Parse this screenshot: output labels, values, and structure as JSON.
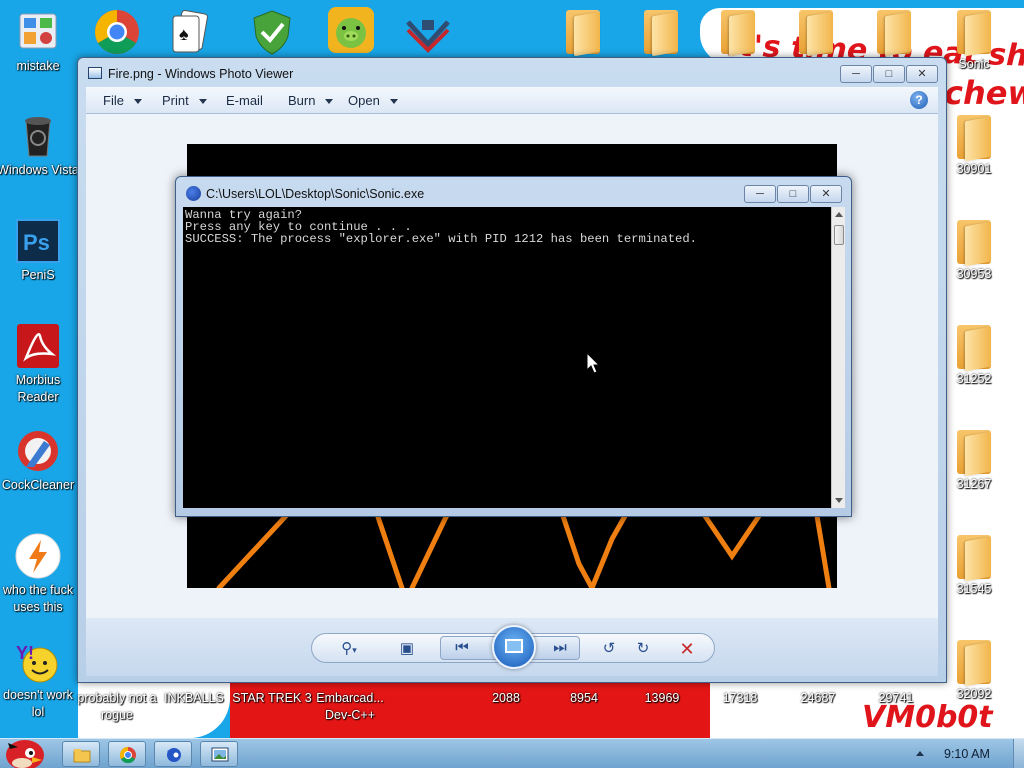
{
  "desktop": {
    "background_text_top": "It's time to eat shit",
    "background_text_chew": "chew",
    "watermark": "VM0b0t",
    "icons_left": [
      {
        "label": "mistake",
        "icon": "control-panel-icon"
      },
      {
        "label": "Windows Vista",
        "icon": "recycle-bin-icon"
      },
      {
        "label": "PeniS",
        "icon": "photoshop-icon"
      },
      {
        "label": "Morbius Reader",
        "icon": "adobe-reader-icon"
      },
      {
        "label": "CockCleaner",
        "icon": "ccleaner-icon"
      },
      {
        "label": "who the fuck uses this",
        "icon": "winamp-icon"
      },
      {
        "label": "doesn't work lol",
        "icon": "yahoo-messenger-icon"
      }
    ],
    "icons_top": [
      {
        "label": "",
        "icon": "chrome-icon"
      },
      {
        "label": "",
        "icon": "solitaire-icon"
      },
      {
        "label": "",
        "icon": "security-shield-icon"
      },
      {
        "label": "",
        "icon": "bad-piggies-icon"
      },
      {
        "label": "",
        "icon": "vmware-icon"
      }
    ],
    "folder_label_top": "Sonic",
    "folders_right": [
      "30901",
      "30953",
      "31252",
      "31267",
      "31545",
      "32092"
    ],
    "bottom_row": [
      "probably not a rogue",
      "INKBALLS",
      "STAR TREK 3",
      "Embarcad... Dev-C++",
      "2088",
      "8954",
      "13969",
      "17318",
      "24687",
      "29741"
    ]
  },
  "viewer": {
    "title": "Fire.png - Windows Photo Viewer",
    "menu": [
      {
        "label": "File",
        "has_caret": true
      },
      {
        "label": "Print",
        "has_caret": true
      },
      {
        "label": "E-mail",
        "has_caret": false
      },
      {
        "label": "Burn",
        "has_caret": true
      },
      {
        "label": "Open",
        "has_caret": true
      }
    ],
    "help": "?",
    "colors": {
      "photo_bg": "#000000",
      "flames": "#f07f12"
    }
  },
  "console": {
    "title": "C:\\Users\\LOL\\Desktop\\Sonic\\Sonic.exe",
    "lines": [
      "Wanna try again?",
      "Press any key to continue . . .",
      "SUCCESS: The process \"explorer.exe\" with PID 1212 has been terminated."
    ]
  },
  "taskbar": {
    "clock": "9:10 AM",
    "buttons": [
      "explorer-icon",
      "chrome-icon",
      "sonic-icon",
      "photo-viewer-icon"
    ]
  }
}
